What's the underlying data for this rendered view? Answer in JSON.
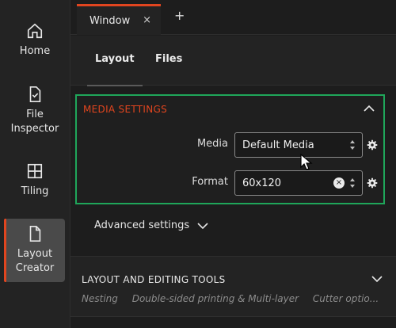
{
  "sidebar": {
    "items": [
      {
        "label": "Home",
        "icon": "home-icon"
      },
      {
        "label": "File\nInspector",
        "icon": "file-check-icon"
      },
      {
        "label": "Tiling",
        "icon": "tiling-icon"
      },
      {
        "label": "Layout\nCreator",
        "icon": "document-icon",
        "active": true
      }
    ]
  },
  "tabs": {
    "window_tab_label": "Window",
    "close_glyph": "×",
    "add_glyph": "+"
  },
  "subtabs": [
    {
      "label": "Layout",
      "active": true
    },
    {
      "label": "Files"
    }
  ],
  "media_settings": {
    "title": "MEDIA SETTINGS",
    "media_label": "Media",
    "media_value": "Default Media",
    "format_label": "Format",
    "format_value": "60x120",
    "clear_glyph": "×"
  },
  "advanced": {
    "label": "Advanced settings"
  },
  "layout_tools": {
    "title": "LAYOUT AND EDITING TOOLS",
    "items": [
      "Nesting",
      "Double-sided printing & Multi-layer",
      "Cutter optio..."
    ]
  },
  "colors": {
    "accent": "#e1451f",
    "highlight_border": "#1fa65a"
  }
}
